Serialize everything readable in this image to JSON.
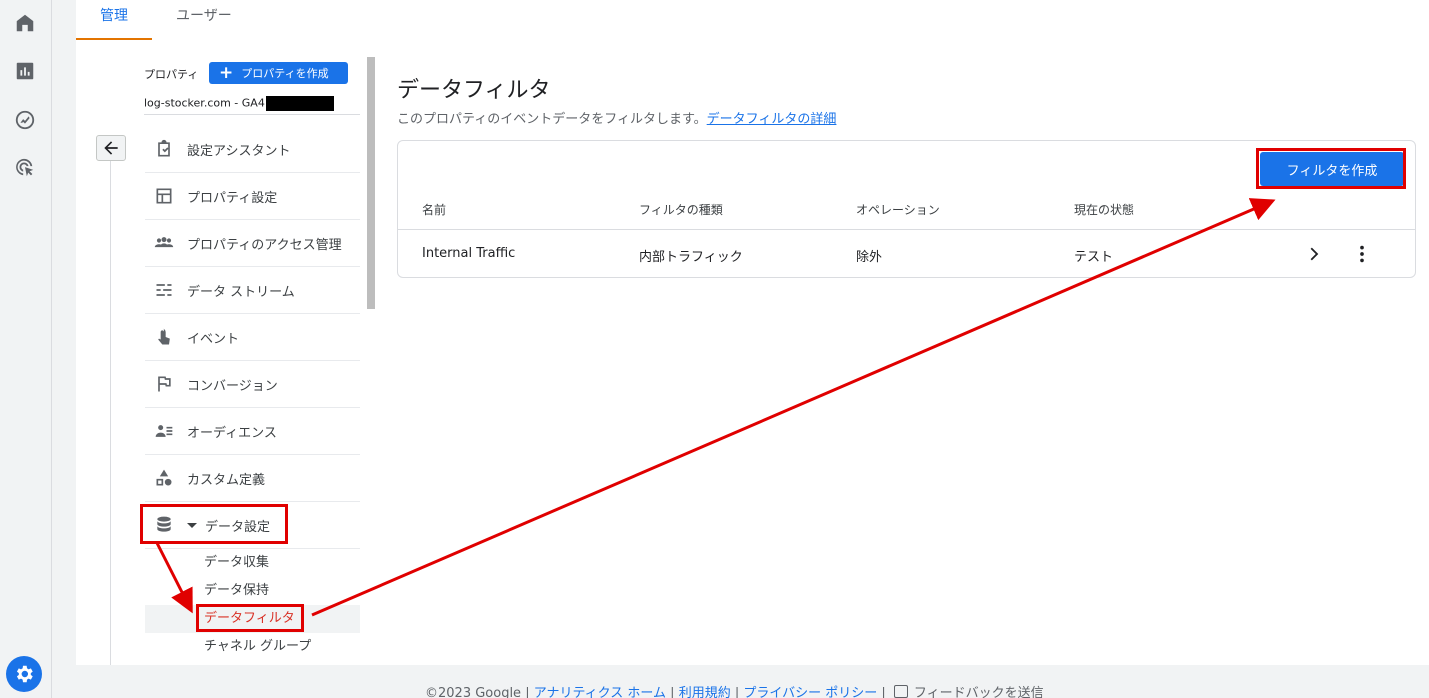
{
  "tabs": {
    "admin": "管理",
    "user": "ユーザー"
  },
  "property": {
    "label": "プロパティ",
    "create_button": "プロパティを作成",
    "account": "log-stocker.com - GA4"
  },
  "nav": {
    "items": [
      {
        "label": "設定アシスタント",
        "icon": "checklist-icon"
      },
      {
        "label": "プロパティ設定",
        "icon": "layout-icon"
      },
      {
        "label": "プロパティのアクセス管理",
        "icon": "people-icon"
      },
      {
        "label": "データ ストリーム",
        "icon": "streams-icon"
      },
      {
        "label": "イベント",
        "icon": "touch-icon"
      },
      {
        "label": "コンバージョン",
        "icon": "flag-icon"
      },
      {
        "label": "オーディエンス",
        "icon": "audience-icon"
      },
      {
        "label": "カスタム定義",
        "icon": "shapes-icon"
      },
      {
        "label": "データ設定",
        "icon": "database-icon"
      }
    ],
    "sub_items": [
      "データ収集",
      "データ保持",
      "データフィルタ",
      "チャネル グループ"
    ]
  },
  "page": {
    "title": "データフィルタ",
    "description": "このプロパティのイベントデータをフィルタします。",
    "details_link": "データフィルタの詳細",
    "create_button": "フィルタを作成"
  },
  "table": {
    "headers": [
      "名前",
      "フィルタの種類",
      "オペレーション",
      "現在の状態"
    ],
    "rows": [
      {
        "name": "Internal Traffic",
        "type": "内部トラフィック",
        "operation": "除外",
        "state": "テスト"
      }
    ]
  },
  "footer": {
    "copyright": "©2023 Google |",
    "links": [
      "アナリティクス ホーム",
      "利用規約",
      "プライバシー ポリシー"
    ],
    "feedback": "フィードバックを送信"
  },
  "colors": {
    "accent": "#1a73e8",
    "highlight": "#e00000",
    "tab_indicator": "#e37400"
  }
}
